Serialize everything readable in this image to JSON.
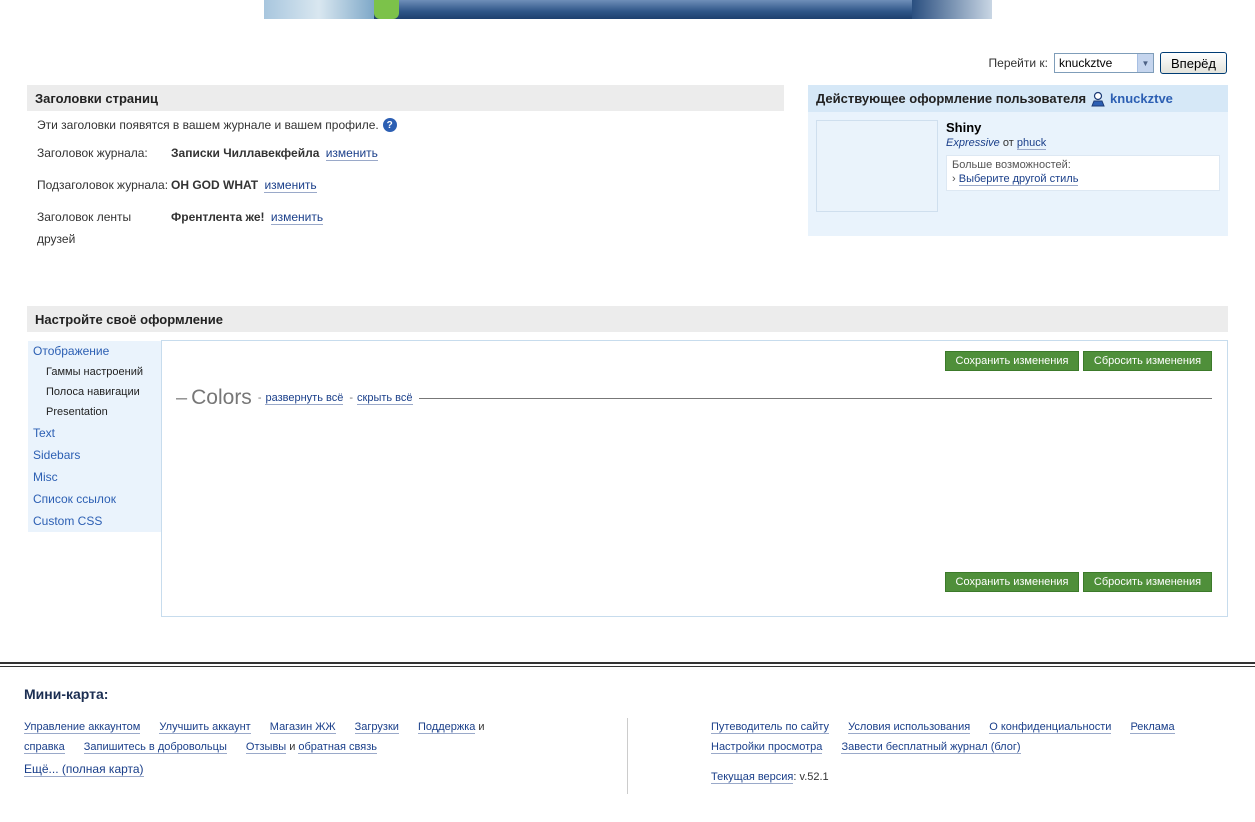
{
  "goto": {
    "label": "Перейти к:",
    "selected": "knuckztve",
    "button": "Вперёд"
  },
  "titles_section": {
    "heading": "Заголовки страниц",
    "intro": "Эти заголовки появятся в вашем журнале и вашем профиле.",
    "rows": [
      {
        "label": "Заголовок журнала:",
        "value": "Записки Чиллавекфейла",
        "link": "изменить"
      },
      {
        "label": "Подзаголовок журнала:",
        "value": "OH GOD WHAT",
        "link": "изменить"
      },
      {
        "label": "Заголовок ленты друзей",
        "value": "Френтлента же!",
        "link": "изменить"
      }
    ]
  },
  "current_style": {
    "heading": "Действующее оформление пользователя",
    "username": "knuckztve",
    "theme_name": "Shiny",
    "layout_name": "Expressive",
    "by": "от",
    "author": "phuck",
    "more_label": "Больше возможностей:",
    "more_link": "Выберите другой стиль"
  },
  "customize": {
    "heading": "Настройте своё оформление",
    "nav": [
      {
        "label": "Отображение",
        "children": [
          "Гаммы настроений",
          "Полоса навигации",
          "Presentation"
        ]
      },
      {
        "label": "Text"
      },
      {
        "label": "Sidebars"
      },
      {
        "label": "Misc"
      },
      {
        "label": "Список ссылок"
      },
      {
        "label": "Custom CSS"
      }
    ],
    "save": "Сохранить изменения",
    "reset": "Сбросить изменения",
    "group_title": "Colors",
    "expand_all": "развернуть всё",
    "collapse_all": "скрыть всё"
  },
  "footer": {
    "minimap": "Мини-карта:",
    "left_links": [
      "Управление аккаунтом",
      "Улучшить аккаунт",
      "Магазин ЖЖ",
      "Загрузки",
      "Поддержка",
      "справка",
      "Запишитесь в добровольцы",
      "Отзывы",
      "обратная связь"
    ],
    "and": "и",
    "more": "Ещё... (полная карта)",
    "right_links": [
      "Путеводитель по сайту",
      "Условия использования",
      "О конфиденциальности",
      "Реклама",
      "Настройки просмотра",
      "Завести бесплатный журнал (блог)"
    ],
    "version_label": "Текущая версия",
    "version": ": v.52.1"
  }
}
